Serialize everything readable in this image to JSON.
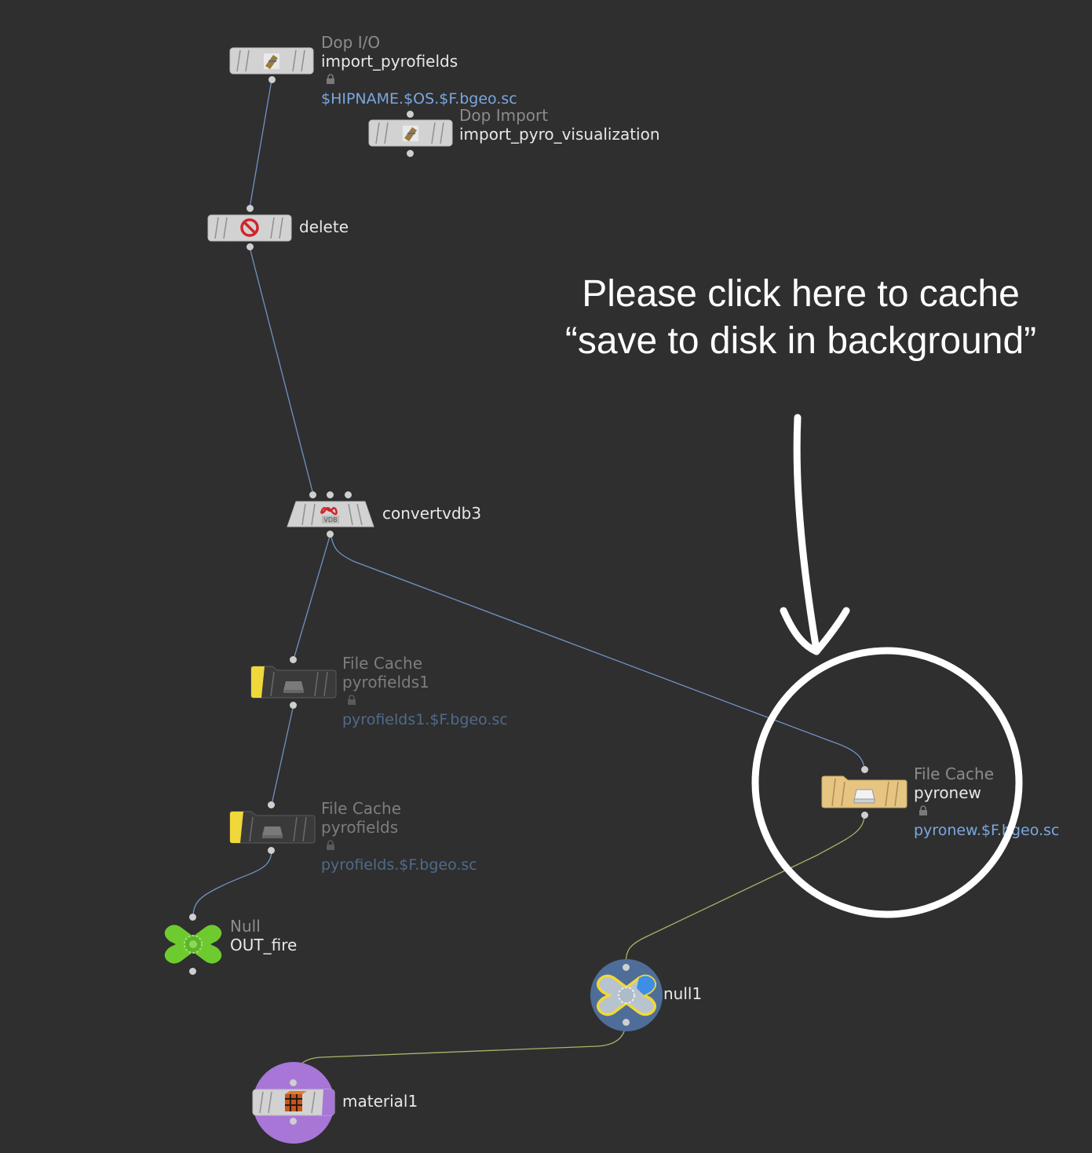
{
  "network": {
    "nodes": [
      {
        "id": "import_pyrofields",
        "type_label": "Dop I/O",
        "name": "import_pyrofields",
        "locked": true,
        "output_path": "$HIPNAME.$OS.$F.bgeo.sc",
        "icon": "dop-import-icon"
      },
      {
        "id": "import_pyro_visualization",
        "type_label": "Dop Import",
        "name": "import_pyro_visualization",
        "icon": "dop-import-icon"
      },
      {
        "id": "delete",
        "type_label": "",
        "name": "delete",
        "icon": "delete-icon"
      },
      {
        "id": "convertvdb3",
        "type_label": "",
        "name": "convertvdb3",
        "icon": "vdb-icon"
      },
      {
        "id": "pyrofields1",
        "type_label": "File Cache",
        "name": "pyrofields1",
        "locked": true,
        "output_path": "pyrofields1.$F.bgeo.sc",
        "icon": "disk-icon",
        "bypassed": true
      },
      {
        "id": "pyrofields",
        "type_label": "File Cache",
        "name": "pyrofields",
        "locked": true,
        "output_path": "pyrofields.$F.bgeo.sc",
        "icon": "disk-icon",
        "bypassed": true
      },
      {
        "id": "OUT_fire",
        "type_label": "Null",
        "name": "OUT_fire",
        "icon": "null-icon",
        "color": "#6ecb2f"
      },
      {
        "id": "pyronew",
        "type_label": "File Cache",
        "name": "pyronew",
        "locked": true,
        "output_path": "pyronew.$F.bgeo.sc",
        "icon": "disk-icon",
        "color": "#e6c583"
      },
      {
        "id": "null1",
        "type_label": "",
        "name": "null1",
        "icon": "null-icon",
        "display_flag": true
      },
      {
        "id": "material1",
        "type_label": "",
        "name": "material1",
        "icon": "material-icon",
        "render_flag": true
      }
    ],
    "connections": [
      {
        "from": "import_pyrofields",
        "to": "delete"
      },
      {
        "from": "delete",
        "to": "convertvdb3"
      },
      {
        "from": "convertvdb3",
        "to": "pyrofields1"
      },
      {
        "from": "convertvdb3",
        "to": "pyronew"
      },
      {
        "from": "pyrofields1",
        "to": "pyrofields"
      },
      {
        "from": "pyrofields",
        "to": "OUT_fire"
      },
      {
        "from": "pyronew",
        "to": "null1"
      },
      {
        "from": "null1",
        "to": "material1"
      }
    ]
  },
  "annotation": {
    "line1": "Please click here to cache",
    "line2": "“save to disk in background”",
    "target": "pyronew"
  },
  "colors": {
    "background": "#2f2f2f",
    "wire_main": "#6f93c4",
    "wire_display": "#a9b36a",
    "path_text": "#7aa7e0",
    "null_green": "#6ecb2f",
    "file_cache_tan": "#e6c583",
    "bypass_yellow": "#f0d83a",
    "display_flag_blue": "#4f6d99",
    "render_flag_purple": "#a776d6"
  }
}
